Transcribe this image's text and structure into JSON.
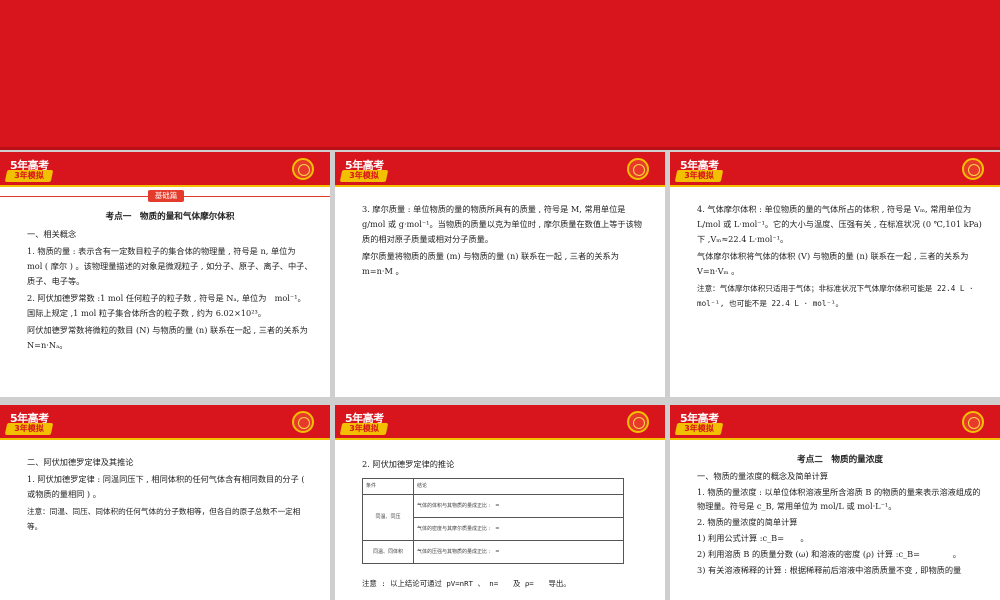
{
  "header": {
    "logo_top": "5年高考",
    "logo_bottom": "3年模拟"
  },
  "slide1": {
    "section_tag": "基础篇",
    "title": "考点一　物质的量和气体摩尔体积",
    "paras": [
      "一、相关概念",
      "1. 物质的量 : 表示含有一定数目粒子的集合体的物理量 , 符号是 n, 单位为 mol ( 摩尔 ) 。该物理量描述的对象是微观粒子 , 如分子、原子、离子、中子、质子、电子等。",
      "2. 阿伏加德罗常数 :1 mol  任何粒子的粒子数 , 符号是 Nₐ, 单位为　mol⁻¹。国际上规定 ,1 mol  粒子集合体所含的粒子数 , 约为 6.02×10²³。",
      "阿伏加德罗常数将微粒的数目 (N) 与物质的量 (n) 联系在一起 , 三者的关系为 N=n·Nₐ。"
    ]
  },
  "slide2": {
    "paras": [
      "3. 摩尔质量 : 单位物质的量的物质所具有的质量 , 符号是 M, 常用单位是 g/mol 或 g·mol⁻¹。当物质的质量以克为单位时 , 摩尔质量在数值上等于该物质的相对原子质量或相对分子质量。",
      "摩尔质量将物质的质量 (m) 与物质的量 (n) 联系在一起 , 三者的关系为 m=n·M 。"
    ]
  },
  "slide3": {
    "paras": [
      "4. 气体摩尔体积 : 单位物质的量的气体所占的体积 , 符号是 Vₘ, 常用单位为 L/mol 或 L·mol⁻¹。它的大小与温度、压强有关 , 在标准状况 (0 ℃,101 kPa) 下 ,Vₘ≈22.4 L·mol⁻¹。",
      "气体摩尔体积将气体的体积 (V) 与物质的量 (n) 联系在一起 , 三者的关系为 V=n·Vₘ 。"
    ],
    "note": "注意：气体摩尔体积只适用于气体；非标准状况下气体摩尔体积可能是 22.4 L · mol⁻¹, 也可能不是 22.4 L · mol⁻¹。"
  },
  "slide4": {
    "paras": [
      "二、阿伏加德罗定律及其推论",
      "1. 阿伏加德罗定律 : 同温同压下 , 相同体积的任何气体含有相同数目的分子 ( 或物质的量相同 ) 。"
    ],
    "note": "注意：同温、同压、同体积的任何气体的分子数相等，但各自的原子总数不一定相等。"
  },
  "slide5": {
    "heading": "2. 阿伏加德罗定律的推论",
    "table": {
      "headers": [
        "条件",
        "结论"
      ],
      "group1_cond": "同温、同压",
      "group2_cond": "同温、同体积",
      "rows": [
        "气体的体积与其物质的量成正比 :　=",
        "气体的密度与其摩尔质量成正比 :　=",
        "气体的压强与其物质的量成正比 :　="
      ]
    },
    "note": "注意 : 以上结论可通过 pV=nRT 、 n=　　及 ρ=　　导出。"
  },
  "slide6": {
    "title": "考点二　物质的量浓度",
    "paras": [
      "一、物质的量浓度的概念及简单计算",
      "1. 物质的量浓度 : 以单位体积溶液里所含溶质 B  的物质的量来表示溶液组成的物理量。符号是 c_B, 常用单位为 mol/L 或 mol·L⁻¹。",
      "2. 物质的量浓度的简单计算",
      "1) 利用公式计算 :c_B=　　。",
      "2) 利用溶质 B 的质量分数 (ω) 和溶液的密度 (ρ) 计算 :c_B=　　　　。",
      "3) 有关溶液稀释的计算 : 根据稀释前后溶液中溶质质量不变 , 即物质的量"
    ]
  }
}
